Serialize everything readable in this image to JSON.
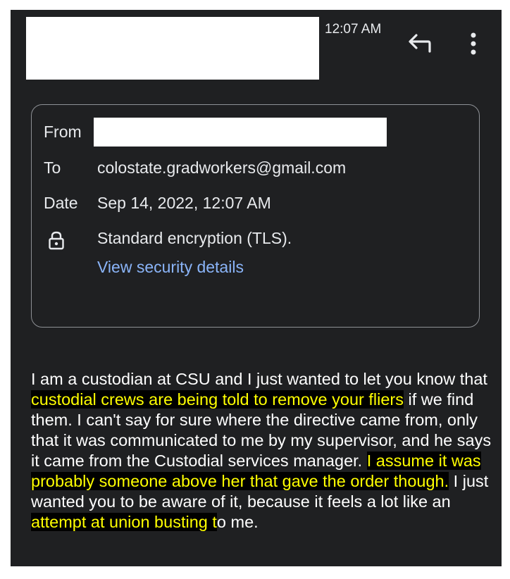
{
  "header": {
    "time": "12:07 AM",
    "reply_icon": "reply-icon",
    "more_icon": "more-vert-icon"
  },
  "details": {
    "from_label": "From",
    "to_label": "To",
    "to_value": "colostate.gradworkers@gmail.com",
    "date_label": "Date",
    "date_value": "Sep 14, 2022, 12:07 AM",
    "lock_icon": "lock-icon",
    "encryption_value": "Standard encryption (TLS).",
    "security_link": "View security details"
  },
  "body": {
    "p1": "I am a custodian at CSU and I just wanted to let you know that ",
    "h1": "custodial crews are being told to remove your fliers",
    "p2": " if we find them. I can't say for sure where the directive came from, only that it was communicated to me by my supervisor, and he says it came from the Custodial services manager. ",
    "h2": "I assume it was probably someone above her that gave the order though.",
    "p3": " I just wanted you to be aware of it, because it feels a lot like an ",
    "h3": "attempt at union busting t",
    "p4": "o me."
  },
  "colors": {
    "background": "#1f2022",
    "text": "#e8eaed",
    "link": "#8ab4f8",
    "highlight_text": "#ffff00",
    "highlight_bg": "#000000"
  }
}
